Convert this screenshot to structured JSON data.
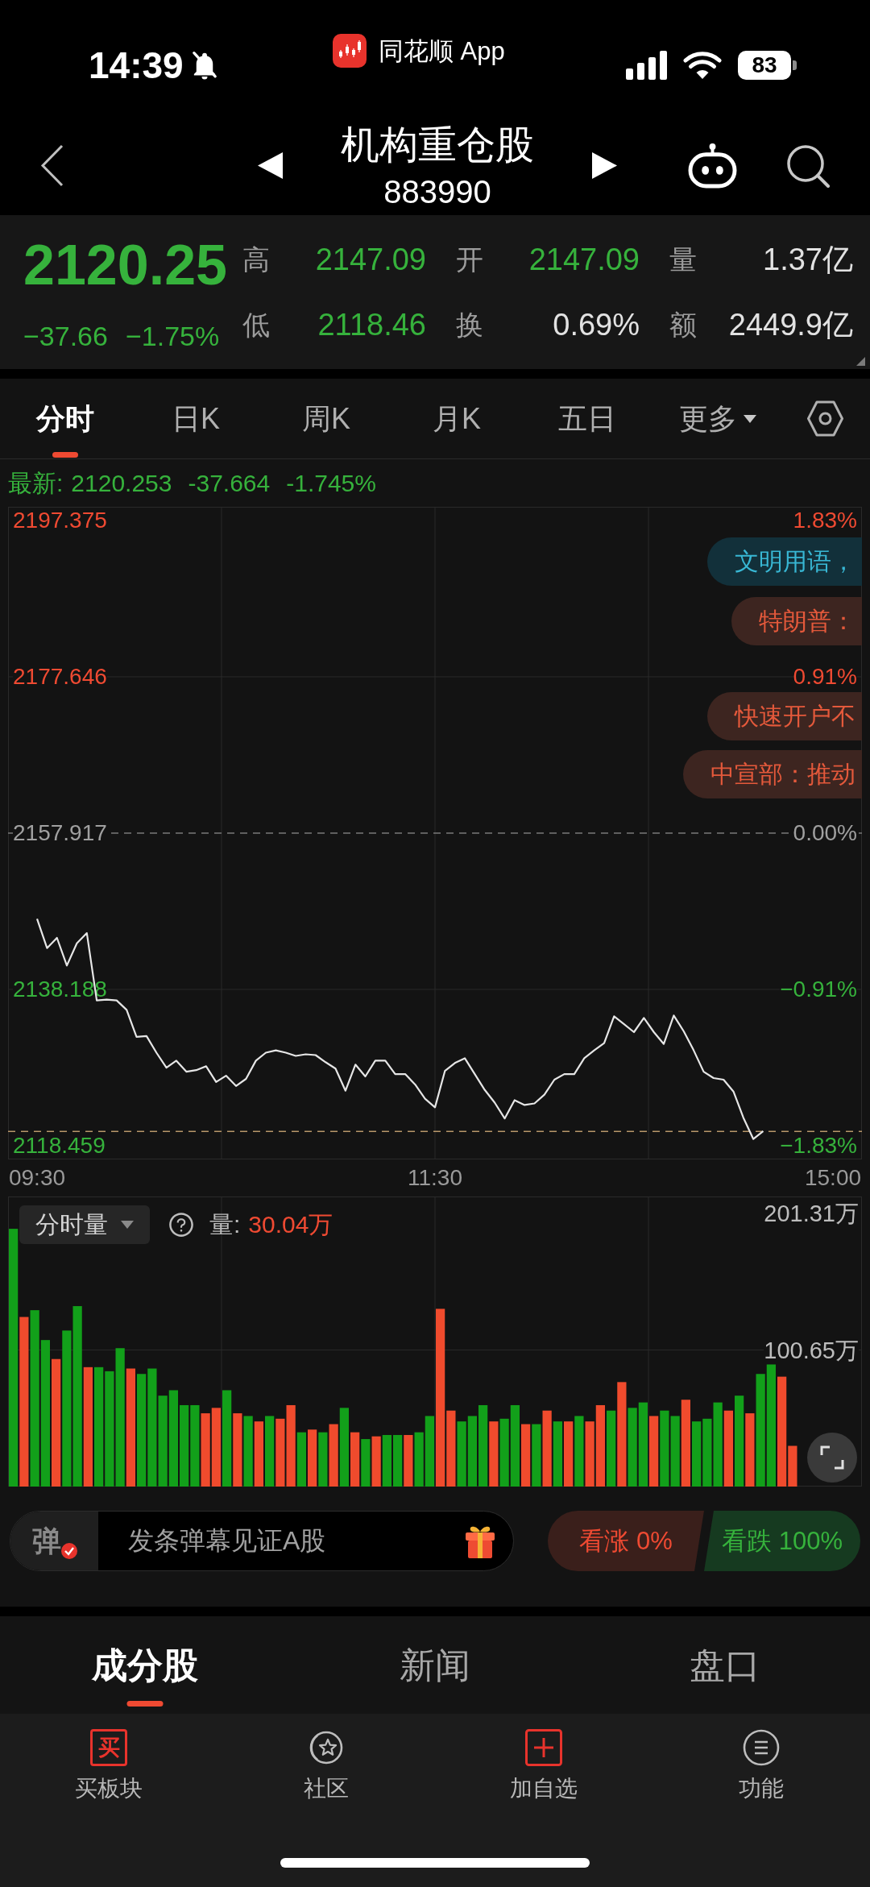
{
  "status_bar": {
    "time": "14:39",
    "app_name": "同花顺 App",
    "battery": "83"
  },
  "header": {
    "title": "机构重仓股",
    "code": "883990"
  },
  "quote": {
    "price": "2120.25",
    "change": "−37.66",
    "change_percent": "−1.75%",
    "falling": true,
    "rows": [
      [
        {
          "label": "高",
          "value": "2147.09",
          "color": "#36b23c"
        },
        {
          "label": "开",
          "value": "2147.09",
          "color": "#36b23c"
        },
        {
          "label": "量",
          "value": "1.37亿",
          "color": "#e2e2e2"
        }
      ],
      [
        {
          "label": "低",
          "value": "2118.46",
          "color": "#36b23c"
        },
        {
          "label": "换",
          "value": "0.69%",
          "color": "#e2e2e2"
        },
        {
          "label": "额",
          "value": "2449.9亿",
          "color": "#e2e2e2"
        }
      ]
    ]
  },
  "chart_tabs": [
    {
      "label": "分时",
      "selected": true,
      "kind": "tab"
    },
    {
      "label": "日K",
      "selected": false,
      "kind": "tab"
    },
    {
      "label": "周K",
      "selected": false,
      "kind": "tab"
    },
    {
      "label": "月K",
      "selected": false,
      "kind": "tab"
    },
    {
      "label": "五日",
      "selected": false,
      "kind": "tab"
    },
    {
      "label": "更多",
      "selected": false,
      "kind": "menu"
    }
  ],
  "price_chart": {
    "latest": {
      "label": "最新:",
      "price": "2120.253",
      "change": "-37.664",
      "change_percent": "-1.745%",
      "falling": true
    },
    "chart_data": {
      "type": "line",
      "categories": [
        "09:30",
        null,
        null,
        null,
        null,
        null,
        null,
        null,
        null,
        null,
        null,
        null,
        null,
        null,
        null,
        null,
        null,
        null,
        null,
        null,
        null,
        null,
        null,
        null,
        null,
        null,
        null,
        null,
        null,
        null,
        null,
        null,
        null,
        null,
        null,
        null,
        null,
        null,
        null,
        null,
        "11:30",
        null,
        null,
        null,
        null,
        null,
        null,
        null,
        null,
        null,
        null,
        null,
        null,
        null,
        null,
        null,
        null,
        null,
        null,
        null,
        null,
        null,
        null,
        null,
        null,
        null,
        null,
        null,
        null,
        null,
        null,
        null,
        null,
        null,
        null,
        null,
        null,
        null,
        null,
        null,
        "15:00"
      ],
      "series": [
        {
          "color": "#e6e6e6",
          "values": [
            2147.1,
            2143.4,
            2144.7,
            2141.2,
            2144.0,
            2145.3,
            2136.8,
            2136.9,
            2136.8,
            2135.6,
            2132.2,
            2132.3,
            2130.2,
            2128.3,
            2129.2,
            2127.8,
            2128.0,
            2128.5,
            2126.5,
            2127.3,
            2126.0,
            2126.9,
            2129.2,
            2130.2,
            2130.5,
            2130.2,
            2129.8,
            2130.0,
            2129.9,
            2129.0,
            2128.2,
            2125.4,
            2128.7,
            2127.2,
            2129.2,
            2129.2,
            2127.5,
            2127.5,
            2126.2,
            2124.4,
            2123.3,
            2127.9,
            2128.9,
            2129.5,
            2127.5,
            2125.5,
            2123.9,
            2121.9,
            2124.2,
            2123.6,
            2123.8,
            2124.9,
            2126.8,
            2127.5,
            2127.5,
            2129.5,
            2130.5,
            2131.4,
            2134.8,
            2133.8,
            2132.8,
            2134.6,
            2132.8,
            2131.3,
            2134.9,
            2132.9,
            2130.5,
            2127.8,
            2127.0,
            2126.8,
            2125.3,
            2122.0,
            2119.3,
            2120.3,
            null,
            null,
            null,
            null,
            null,
            null,
            null
          ]
        }
      ],
      "ylim": [
        2116.73,
        2199.1
      ],
      "yticks": [
        {
          "value": 2197.375,
          "label": "2197.375"
        },
        {
          "value": 2177.646,
          "label": "2177.646"
        },
        {
          "value": 2157.917,
          "label": "2157.917"
        },
        {
          "value": 2138.188,
          "label": "2138.188"
        },
        {
          "value": 2118.459,
          "label": "2118.459"
        }
      ],
      "ref_lines": [
        {
          "axis": "y",
          "value": 2157.917,
          "color": "#7a7a7a"
        },
        {
          "axis": "y",
          "value": 2120.253,
          "color": "#b8976a"
        }
      ]
    },
    "right_axis": [
      {
        "label": "1.83%",
        "color": "#ef4a32"
      },
      {
        "label": "0.91%",
        "color": "#ef4a32"
      },
      {
        "label": "0.00%",
        "color": "#a0a0a0"
      },
      {
        "label": "−0.91%",
        "color": "#36b23c"
      },
      {
        "label": "−1.83%",
        "color": "#36b23c"
      }
    ],
    "danmaku": [
      {
        "text": "文明用语，",
        "kind": "notice"
      },
      {
        "text": "特朗普：",
        "kind": "news"
      },
      {
        "text": "快速开户不",
        "kind": "news"
      },
      {
        "text": "中宣部：推动",
        "kind": "news"
      }
    ]
  },
  "volume_chart": {
    "selector": "分时量",
    "volume_label": "量:",
    "volume_value": "30.04万",
    "chart_data": {
      "type": "bar",
      "stacked": true,
      "categories": [
        null,
        null,
        null,
        null,
        null,
        null,
        null,
        null,
        null,
        null,
        null,
        null,
        null,
        null,
        null,
        null,
        null,
        null,
        null,
        null,
        null,
        null,
        null,
        null,
        null,
        null,
        null,
        null,
        null,
        null,
        null,
        null,
        null,
        null,
        null,
        null,
        null,
        null,
        null,
        null,
        null,
        null,
        null,
        null,
        null,
        null,
        null,
        null,
        null,
        null,
        null,
        null,
        null,
        null,
        null,
        null,
        null,
        null,
        null,
        null,
        null,
        null,
        null,
        null,
        null,
        null,
        null,
        null,
        null,
        null,
        null,
        null,
        null,
        null,
        null,
        null,
        null,
        null,
        null,
        null
      ],
      "series": [
        {
          "color": "#f04b2d",
          "values": [
            null,
            125,
            null,
            null,
            94,
            null,
            null,
            88,
            null,
            null,
            null,
            87,
            null,
            null,
            null,
            null,
            null,
            null,
            54,
            58,
            null,
            54,
            null,
            48,
            null,
            50,
            60,
            null,
            42,
            null,
            46,
            null,
            40,
            null,
            37,
            null,
            null,
            38,
            null,
            null,
            131,
            56,
            null,
            null,
            null,
            48,
            null,
            null,
            46,
            null,
            56,
            null,
            48,
            null,
            48,
            60,
            null,
            77,
            null,
            null,
            52,
            null,
            null,
            64,
            null,
            null,
            null,
            56,
            null,
            54,
            null,
            null,
            81,
            30,
            null,
            null,
            null,
            null,
            null,
            null
          ]
        },
        {
          "color": "#12a01a",
          "values": [
            190,
            null,
            130,
            108,
            null,
            115,
            133,
            null,
            88,
            85,
            102,
            null,
            83,
            87,
            67,
            71,
            60,
            60,
            null,
            null,
            71,
            null,
            52,
            null,
            52,
            null,
            null,
            40,
            null,
            40,
            null,
            58,
            null,
            35,
            null,
            38,
            38,
            null,
            40,
            52,
            null,
            null,
            48,
            52,
            60,
            null,
            50,
            60,
            null,
            46,
            null,
            48,
            null,
            52,
            null,
            null,
            56,
            null,
            58,
            62,
            null,
            56,
            52,
            null,
            48,
            50,
            62,
            null,
            67,
            null,
            83,
            90,
            null,
            null,
            null,
            null,
            null,
            null,
            null,
            null
          ]
        }
      ],
      "ylim": [
        0,
        213.8
      ],
      "yticks": [
        {
          "value": 100.65,
          "label": "100.65万"
        },
        {
          "value": 201.31,
          "label": "201.31万"
        }
      ]
    }
  },
  "danmaku_bar": {
    "toggle": "弹",
    "placeholder": "发条弹幕见证A股"
  },
  "sentiment": [
    {
      "label": "看涨 0%",
      "kind": "bull"
    },
    {
      "label": "看跌 100%",
      "kind": "bear"
    }
  ],
  "section_tabs": [
    {
      "label": "成分股",
      "selected": true
    },
    {
      "label": "新闻",
      "selected": false
    },
    {
      "label": "盘口",
      "selected": false
    }
  ],
  "toolbar": [
    {
      "label": "买板块",
      "glyph": "买"
    },
    {
      "label": "社区"
    },
    {
      "label": "加自选"
    },
    {
      "label": "功能"
    }
  ]
}
